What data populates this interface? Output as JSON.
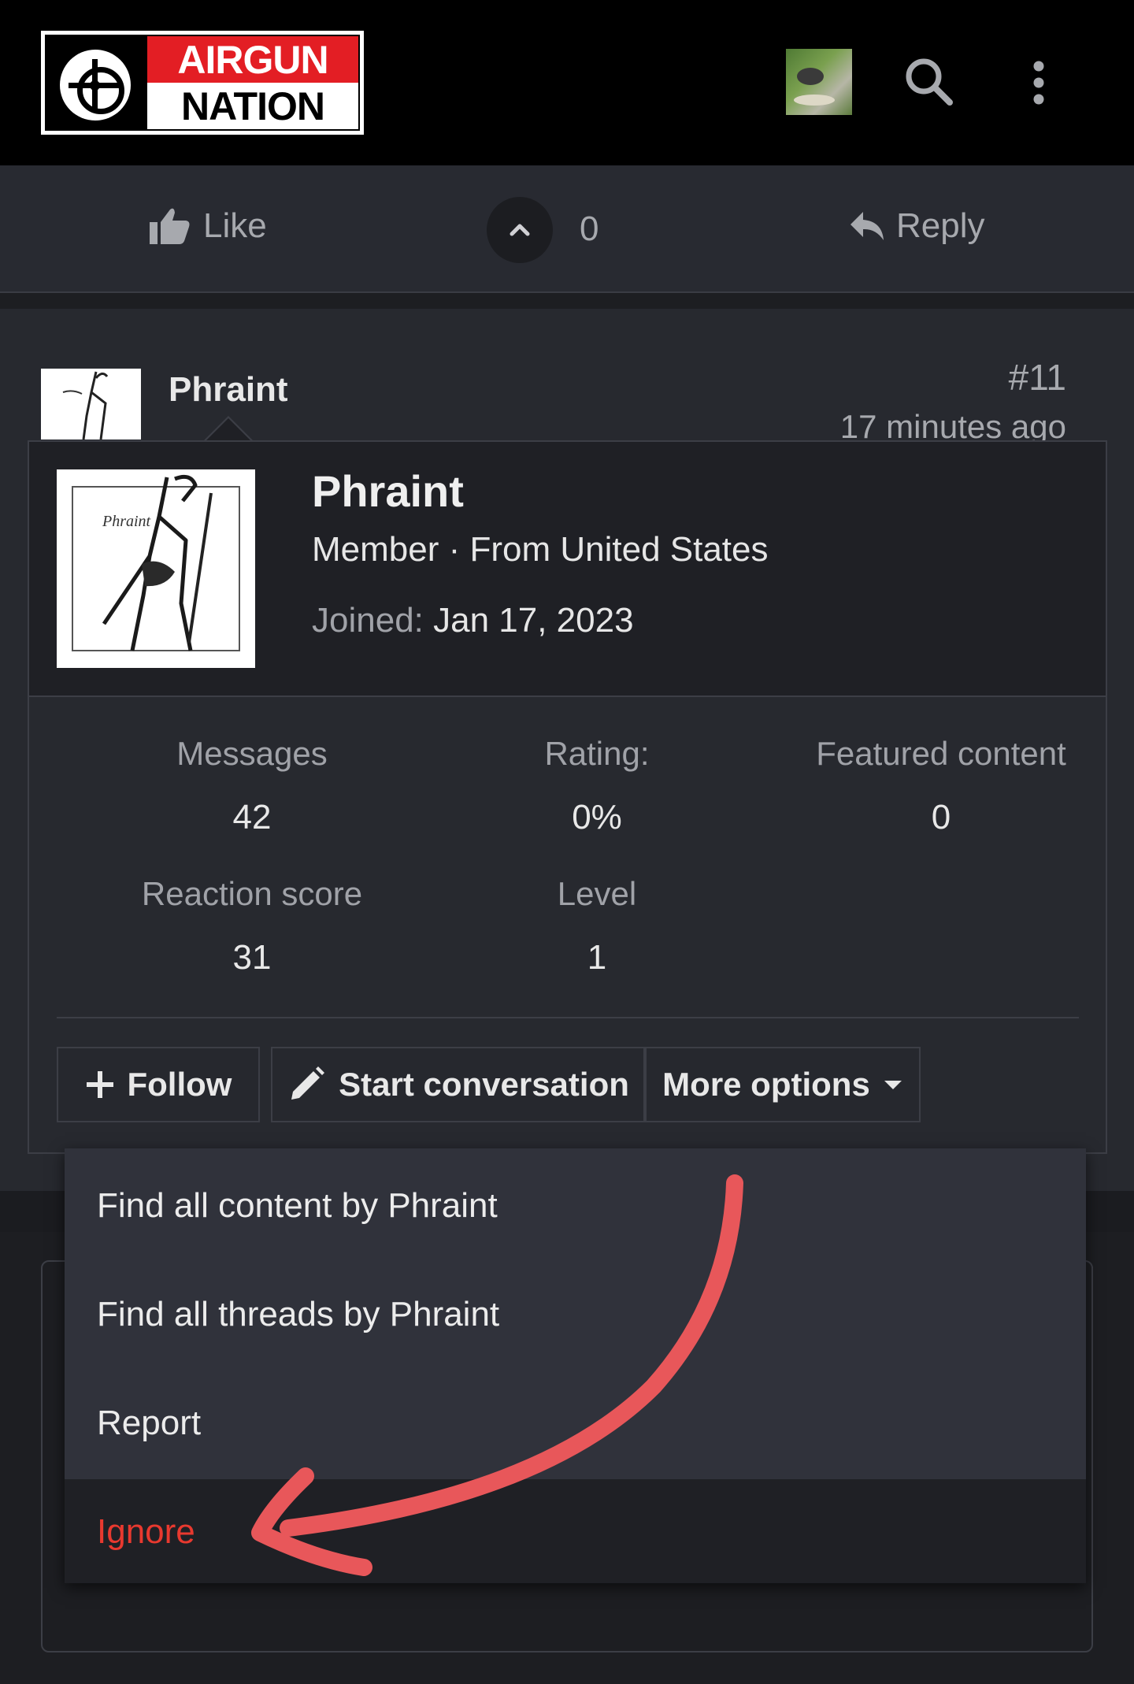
{
  "header": {
    "logo_line1": "AIRGUN",
    "logo_line2": "NATION",
    "icons": {
      "search": "search-icon",
      "menu": "more-vertical-icon"
    }
  },
  "post_actions": {
    "like_label": "Like",
    "vote_count": "0",
    "reply_label": "Reply",
    "icons": {
      "like": "thumbs-up-icon",
      "upvote": "chevron-up-icon",
      "reply": "reply-arrow-icon"
    }
  },
  "post": {
    "author": "Phraint",
    "post_number": "#11",
    "time": "17 minutes ago"
  },
  "member_card": {
    "name": "Phraint",
    "meta": "Member · From United States",
    "joined_label": "Joined:",
    "joined_value": "Jan 17, 2023",
    "stats": [
      {
        "label": "Messages",
        "value": "42"
      },
      {
        "label": "Rating:",
        "value": "0%"
      },
      {
        "label": "Featured content",
        "value": "0"
      },
      {
        "label": "Reaction score",
        "value": "31"
      },
      {
        "label": "Level",
        "value": "1"
      }
    ],
    "buttons": {
      "follow": "Follow",
      "start_conversation": "Start conversation",
      "more_options": "More options"
    }
  },
  "more_menu": {
    "items": [
      {
        "label": "Find all content by Phraint"
      },
      {
        "label": "Find all threads by Phraint"
      },
      {
        "label": "Report"
      },
      {
        "label": "Ignore"
      }
    ]
  },
  "colors": {
    "accent_red": "#e31e24",
    "danger": "#e8392f",
    "annotation": "#e8575a"
  }
}
